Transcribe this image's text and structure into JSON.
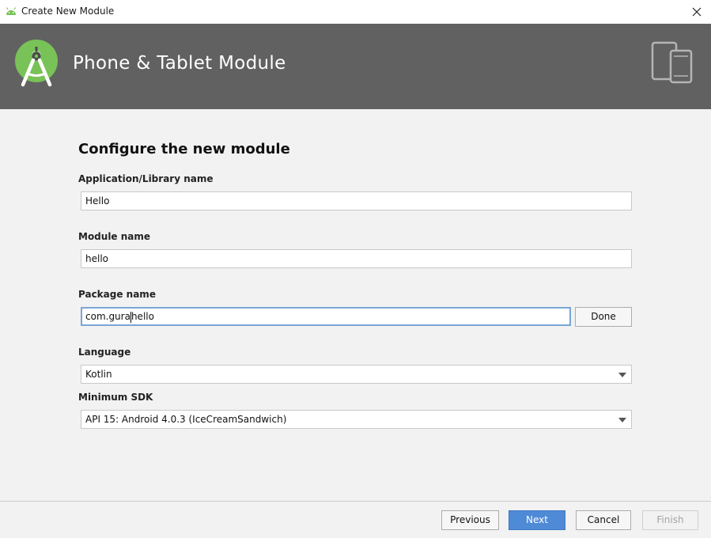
{
  "window": {
    "title": "Create New Module"
  },
  "banner": {
    "heading": "Phone & Tablet Module"
  },
  "form": {
    "section_title": "Configure the new module",
    "app_name": {
      "label": "Application/Library name",
      "value": "Hello"
    },
    "module_name": {
      "label": "Module name",
      "value": "hello"
    },
    "package_name": {
      "label": "Package name",
      "value_before_caret": "com.gura",
      "value_after_caret": "hello",
      "done_label": "Done"
    },
    "language": {
      "label": "Language",
      "value": "Kotlin"
    },
    "min_sdk": {
      "label": "Minimum SDK",
      "value": "API 15: Android 4.0.3 (IceCreamSandwich)"
    }
  },
  "footer": {
    "previous_label": "Previous",
    "next_label": "Next",
    "cancel_label": "Cancel",
    "finish_label": "Finish"
  },
  "icons": {
    "window_icon": "android-icon",
    "close": "close-icon",
    "banner_logo": "android-studio-logo-icon",
    "devices": "phone-tablet-icon",
    "dropdown": "chevron-down-icon"
  },
  "colors": {
    "banner_bg": "#616161",
    "primary_button": "#4f8ad7",
    "focus_border": "#7aa6d6",
    "android_green": "#78c257"
  }
}
